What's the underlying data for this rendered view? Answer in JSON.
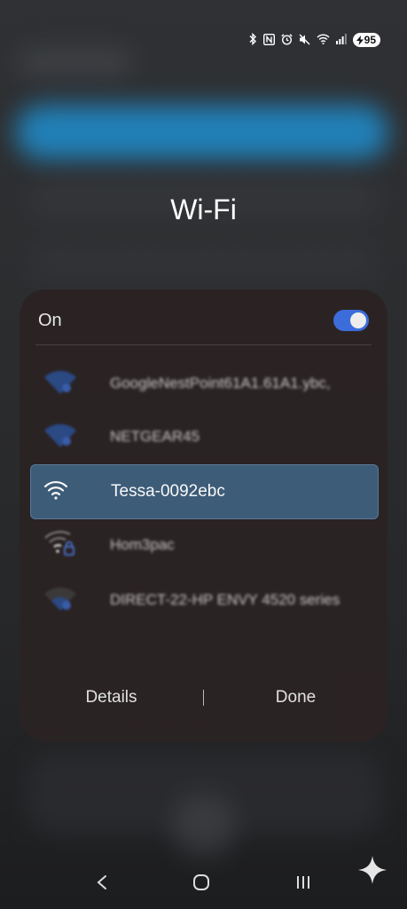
{
  "status_bar": {
    "icons": [
      "bluetooth-icon",
      "nfc-icon",
      "alarm-icon",
      "mute-icon",
      "wifi-icon",
      "signal-icon"
    ],
    "battery_level": "95"
  },
  "page_title": "Wi-Fi",
  "wifi": {
    "toggle_label": "On",
    "enabled": true,
    "networks": [
      {
        "name": "GoogleNestPoint61A1.61A1.ybc,",
        "selected": false
      },
      {
        "name": "NETGEAR45",
        "selected": false
      },
      {
        "name": "Tessa-0092ebc",
        "selected": true
      },
      {
        "name": "Hom3pac",
        "selected": false,
        "locked": true
      },
      {
        "name": "DIRECT-22-HP ENVY 4520 series",
        "selected": false
      }
    ]
  },
  "actions": {
    "details_label": "Details",
    "done_label": "Done"
  },
  "nav": {
    "icons": [
      "back-icon",
      "home-icon",
      "recents-icon",
      "assistant-sparkle-icon"
    ]
  },
  "colors": {
    "accent": "#3d6fe0",
    "selected_row": "#3e5e7b",
    "dialog_bg": "#2b2323"
  }
}
